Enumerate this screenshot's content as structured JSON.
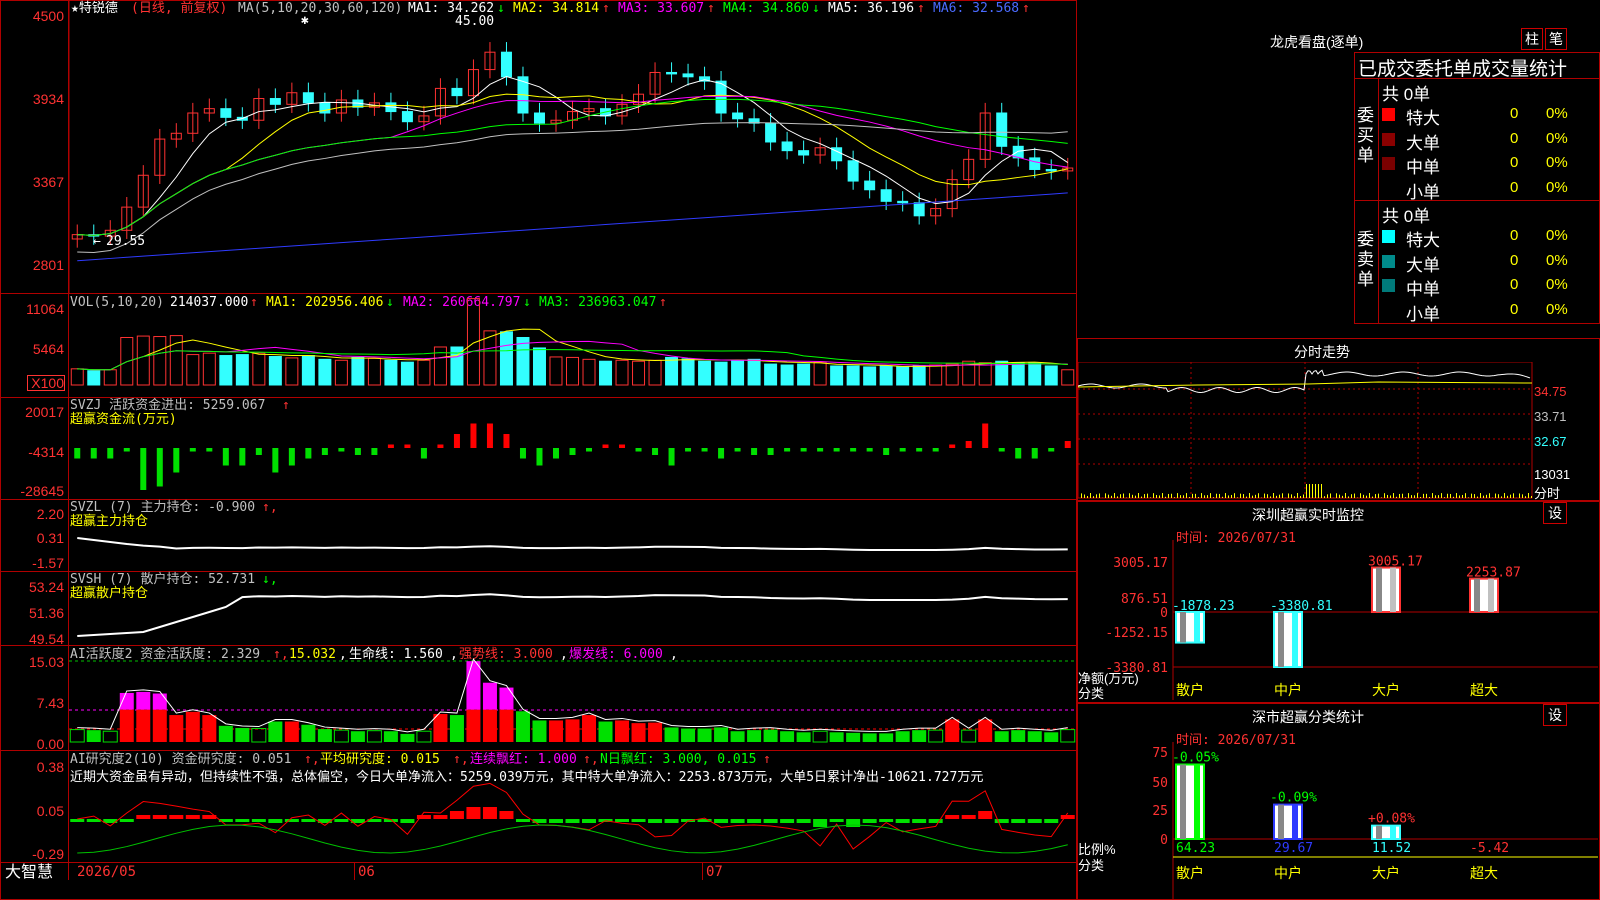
{
  "stock": {
    "name": "★特锐德",
    "period_note": "(日线, 前复权)",
    "ma_params": "MA(5,10,20,30,60,120)",
    "ma1": "MA1: 34.262",
    "ma2": "MA2: 34.814",
    "ma3": "MA3: 33.607",
    "ma4": "MA4: 34.860",
    "ma5": "MA5: 36.196",
    "ma6": "MA6: 32.568",
    "high_label": "45.00",
    "low_label": "29.55"
  },
  "price_axis": [
    "4500",
    "3934",
    "3367",
    "2801"
  ],
  "vol": {
    "title": "VOL(5,10,20)",
    "value": "214037.000",
    "ma1": "MA1: 202956.406",
    "ma2": "MA2: 260664.797",
    "ma3": "MA3: 236963.047",
    "axis": [
      "11064",
      "5464",
      "X100"
    ]
  },
  "svzj": {
    "title": "SVZJ  活跃资金进出: 5259.067",
    "sub": "超赢资金流(万元)",
    "axis": [
      "20017",
      "-4314",
      "-28645"
    ]
  },
  "svzl": {
    "title": "SVZL (7) 主力持仓: -0.900",
    "sub": "超赢主力持仓",
    "axis": [
      "2.20",
      "0.31",
      "-1.57"
    ]
  },
  "svsh": {
    "title": "SVSH (7) 散户持仓: 52.731",
    "sub": "超赢散户持仓",
    "axis": [
      "53.24",
      "51.36",
      "49.54"
    ]
  },
  "ai2": {
    "title": "AI活跃度2 资金活跃度: 2.329",
    "v2": "15.032",
    "life": "生命线: 1.560",
    "strong": "强势线: 3.000",
    "burst": "爆发线: 6.000",
    "axis": [
      "15.03",
      "7.43",
      "0.00"
    ]
  },
  "ai_research": {
    "title": "AI研究度2(10) 资金研究度: 0.051",
    "avg": "平均研究度: 0.015",
    "cont": "连续飘红: 1.000",
    "nday": "N日飘红: 3.000, 0.015",
    "comment": "近期大资金虽有异动，但持续性不强，总体偏空，今日大单净流入：5259.039万元，其中特大单净流入：2253.873万元，大单5日累计净出-10621.727万元",
    "axis": [
      "0.38",
      "0.05",
      "-0.29"
    ]
  },
  "date_axis": [
    "2026/05",
    "06",
    "07"
  ],
  "brand": "大智慧",
  "right": {
    "lhb_title": "龙虎看盘(逐单)",
    "btn_bar": "柱",
    "btn_pen": "笔",
    "stats_title": "已成交委托单成交量统计",
    "buy_label": "委买单",
    "sell_label": "委卖单",
    "buy_total": "共 0单",
    "sell_total": "共 0单",
    "rows": [
      {
        "name": "特大",
        "v": "0",
        "p": "0%",
        "color": "#ff0000"
      },
      {
        "name": "大单",
        "v": "0",
        "p": "0%",
        "color": "#8b0000"
      },
      {
        "name": "中单",
        "v": "0",
        "p": "0%",
        "color": "#7a0000"
      },
      {
        "name": "小单",
        "v": "0",
        "p": "0%",
        "color": ""
      }
    ],
    "sell_rows": [
      {
        "name": "特大",
        "v": "0",
        "p": "0%",
        "color": "#00ffff"
      },
      {
        "name": "大单",
        "v": "0",
        "p": "0%",
        "color": "#008b8b"
      },
      {
        "name": "中单",
        "v": "0",
        "p": "0%",
        "color": "#007a7a"
      },
      {
        "name": "小单",
        "v": "0",
        "p": "0%",
        "color": ""
      }
    ],
    "intraday_title": "分时走势",
    "intraday_axis": [
      "34.75",
      "33.71",
      "32.67",
      "13031",
      "分时"
    ],
    "sz_title": "深圳超赢实时监控",
    "sz_btn": "设",
    "sz_time": "时间: 2026/07/31",
    "sz_axis": [
      "3005.17",
      "876.51",
      "0",
      "-1252.15",
      "-3380.81"
    ],
    "sz_bars": [
      {
        "cat": "散户",
        "val": -1878.23,
        "label": "-1878.23"
      },
      {
        "cat": "中户",
        "val": -3380.81,
        "label": "-3380.81"
      },
      {
        "cat": "大户",
        "val": 3005.17,
        "label": "3005.17"
      },
      {
        "cat": "超大",
        "val": 2253.87,
        "label": "2253.87"
      }
    ],
    "sz_net": "净额(万元)",
    "sz_class": "分类",
    "cls_title": "深市超赢分类统计",
    "cls_btn": "设",
    "cls_time": "时间: 2026/07/31",
    "cls_axis": [
      "75",
      "50",
      "25",
      "0"
    ],
    "cls_bars": [
      {
        "cat": "散户",
        "val": 64.23,
        "label": "64.23",
        "chg": "-0.05%"
      },
      {
        "cat": "中户",
        "val": 29.67,
        "label": "29.67",
        "chg": "-0.09%"
      },
      {
        "cat": "大户",
        "val": 11.52,
        "label": "11.52",
        "chg": "+0.08%"
      },
      {
        "cat": "超大",
        "val": -5.42,
        "label": "-5.42",
        "chg": ""
      }
    ],
    "cls_ratio": "比例%",
    "cls_class": "分类"
  }
}
